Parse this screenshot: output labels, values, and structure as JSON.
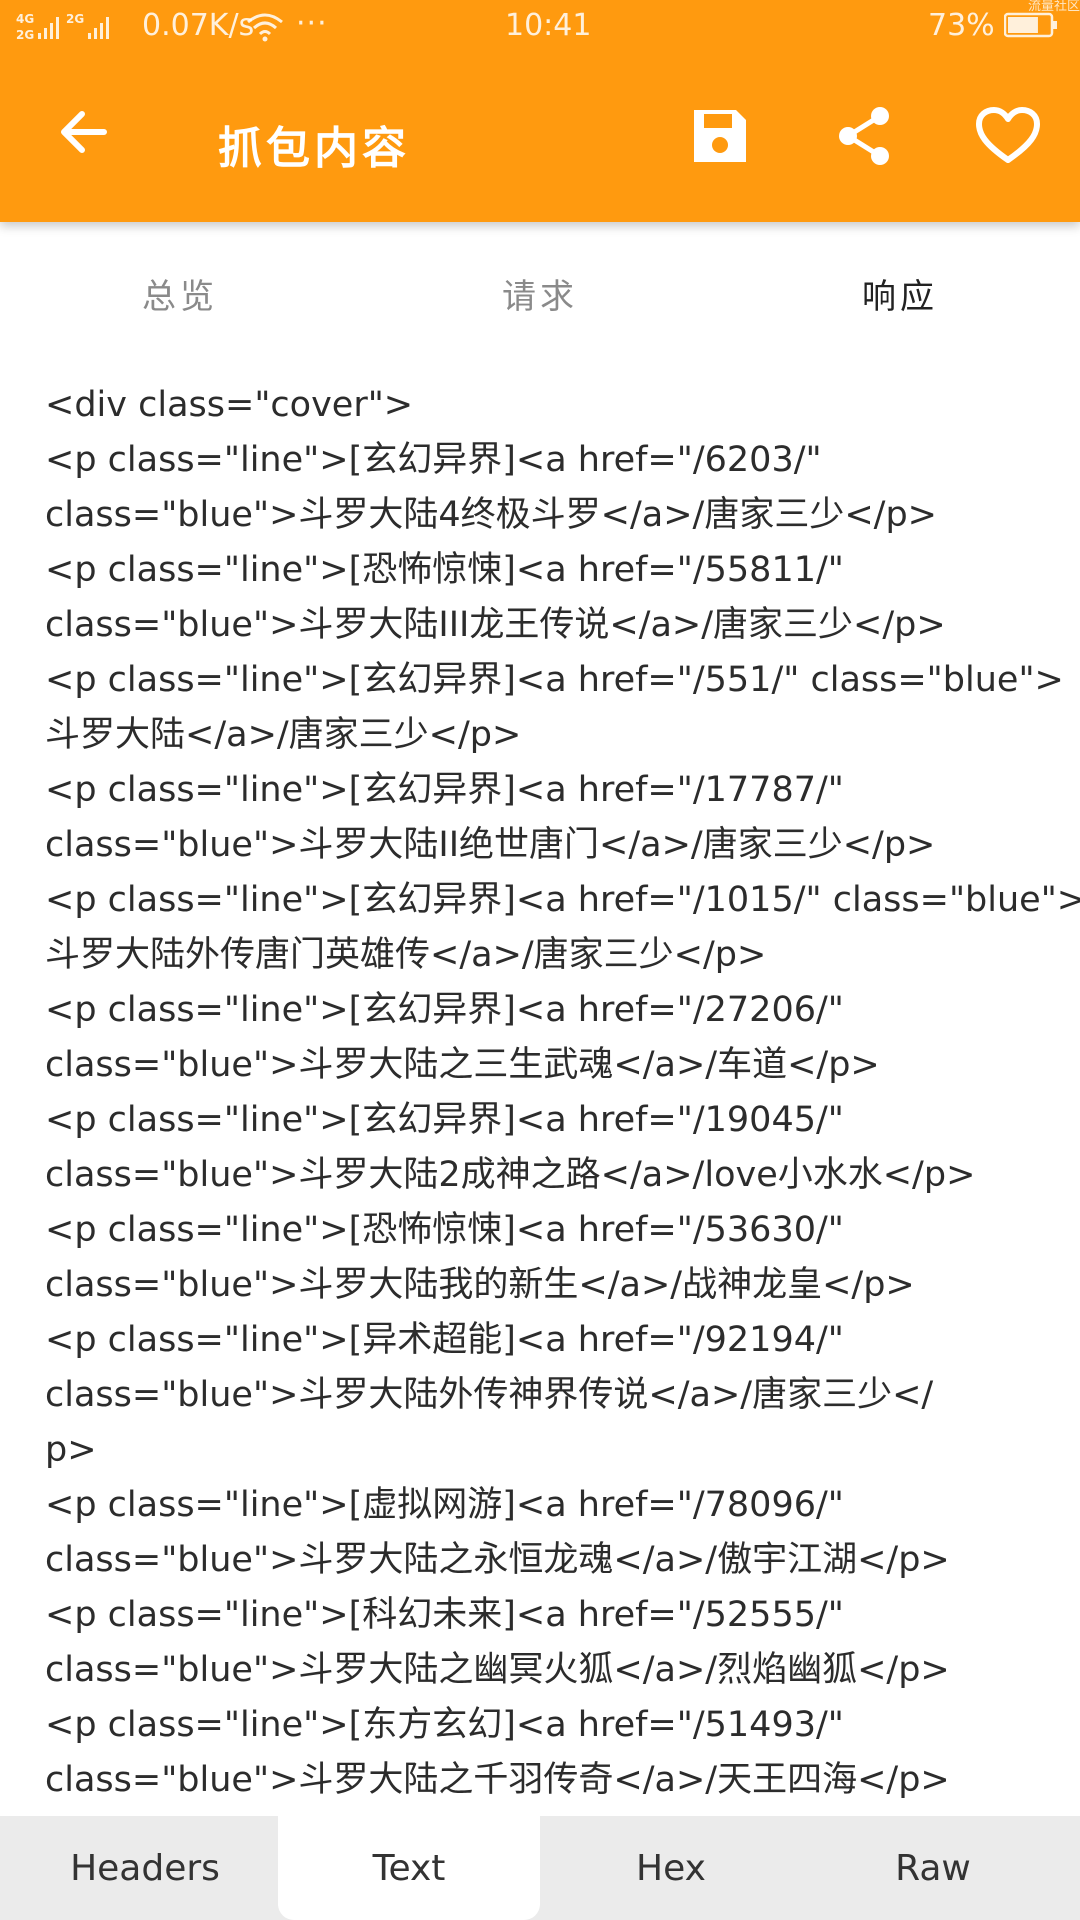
{
  "status_bar": {
    "network": "4G 2G",
    "speed": "0.07K/s",
    "dots": "···",
    "time": "10:41",
    "battery": "73%",
    "battery_level": 0.73,
    "watermark": "流量社区"
  },
  "toolbar": {
    "title": "抓包内容",
    "back_icon": "arrow-left-icon",
    "save_icon": "save-icon",
    "share_icon": "share-icon",
    "favorite_icon": "heart-icon"
  },
  "tabs": [
    {
      "label": "总览",
      "selected": false
    },
    {
      "label": "请求",
      "selected": false
    },
    {
      "label": "响应",
      "selected": true
    }
  ],
  "colors": {
    "toolbar": "#ff9a0f",
    "tab_indicator": "#2e9bd6",
    "bottom_bar": "#ebebeb"
  },
  "response_text": {
    "lines": [
      "<div class=\"cover\">",
      "<p class=\"line\">[玄幻异界]<a href=\"/6203/\"",
      "class=\"blue\">斗罗大陆4终极斗罗</a>/唐家三少</p>",
      "<p class=\"line\">[恐怖惊悚]<a href=\"/55811/\"",
      "class=\"blue\">斗罗大陆III龙王传说</a>/唐家三少</p>",
      "<p class=\"line\">[玄幻异界]<a href=\"/551/\" class=\"blue\">",
      "斗罗大陆</a>/唐家三少</p>",
      "<p class=\"line\">[玄幻异界]<a href=\"/17787/\"",
      "class=\"blue\">斗罗大陆II绝世唐门</a>/唐家三少</p>",
      "<p class=\"line\">[玄幻异界]<a href=\"/1015/\" class=\"blue\">",
      "斗罗大陆外传唐门英雄传</a>/唐家三少</p>",
      "<p class=\"line\">[玄幻异界]<a href=\"/27206/\"",
      "class=\"blue\">斗罗大陆之三生武魂</a>/车道</p>",
      "<p class=\"line\">[玄幻异界]<a href=\"/19045/\"",
      "class=\"blue\">斗罗大陆2成神之路</a>/love小水水</p>",
      "<p class=\"line\">[恐怖惊悚]<a href=\"/53630/\"",
      "class=\"blue\">斗罗大陆我的新生</a>/战神龙皇</p>",
      "<p class=\"line\">[异术超能]<a href=\"/92194/\"",
      "class=\"blue\">斗罗大陆外传神界传说</a>/唐家三少</",
      "p>",
      "<p class=\"line\">[虚拟网游]<a href=\"/78096/\"",
      "class=\"blue\">斗罗大陆之永恒龙魂</a>/傲宇江湖</p>",
      "<p class=\"line\">[科幻未来]<a href=\"/52555/\"",
      "class=\"blue\">斗罗大陆之幽冥火狐</a>/烈焰幽狐</p>",
      "<p class=\"line\">[东方玄幻]<a href=\"/51493/\"",
      "class=\"blue\">斗罗大陆之千羽传奇</a>/天王四海</p>"
    ]
  },
  "bottom_tabs": [
    {
      "label": "Headers",
      "selected": false
    },
    {
      "label": "Text",
      "selected": true
    },
    {
      "label": "Hex",
      "selected": false
    },
    {
      "label": "Raw",
      "selected": false
    }
  ]
}
